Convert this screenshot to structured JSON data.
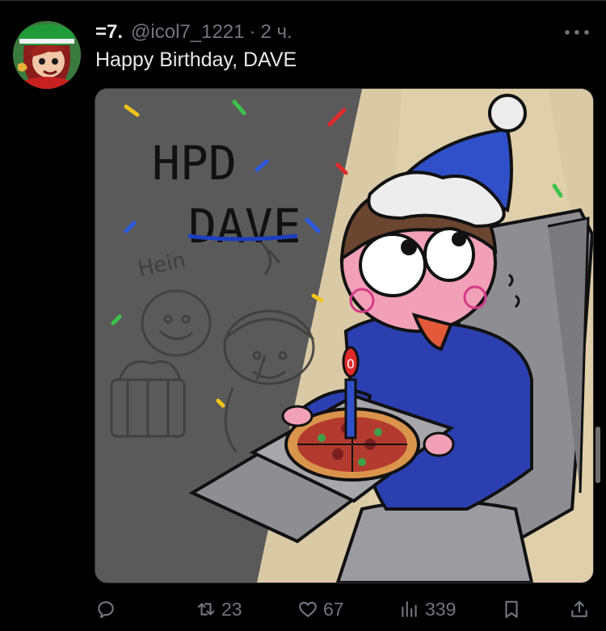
{
  "tweet": {
    "author_name": "=7.",
    "author_handle": "@icol7_1221",
    "separator": "·",
    "timestamp": "2 ч.",
    "text": "Happy Birthday, DAVE",
    "avatar_icon": "avatar-image",
    "more_icon": "more-horizontal-icon"
  },
  "media": {
    "handwritten_title_line1": "HPD",
    "handwritten_title_line2": "DAVE",
    "sketch_label": "Hein",
    "candle_number": "0"
  },
  "actions": {
    "reply": {
      "icon": "reply-icon",
      "count": ""
    },
    "retweet": {
      "icon": "retweet-icon",
      "count": "23"
    },
    "like": {
      "icon": "heart-icon",
      "count": "67"
    },
    "views": {
      "icon": "views-icon",
      "count": "339"
    },
    "bookmark": {
      "icon": "bookmark-icon",
      "count": ""
    },
    "share": {
      "icon": "share-icon",
      "count": ""
    }
  },
  "colors": {
    "background": "#000000",
    "text_primary": "#e7e9ea",
    "text_secondary": "#71767b",
    "divider": "#2f3336"
  }
}
